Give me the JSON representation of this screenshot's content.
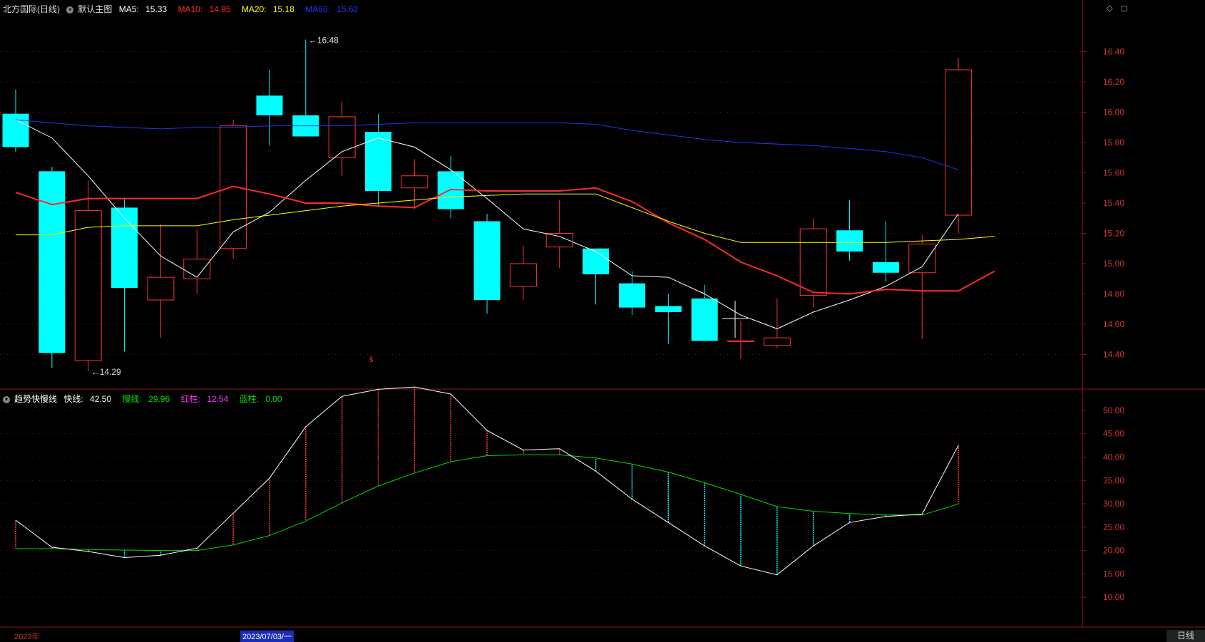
{
  "main_header": {
    "stock": "北方国际(日线)",
    "template": "默认主图",
    "ma5_label": "MA5:",
    "ma5_value": "15.33",
    "ma5_color": "#ffffff",
    "ma10_label": "MA10:",
    "ma10_value": "14.95",
    "ma10_color": "#ff2a2a",
    "ma20_label": "MA20:",
    "ma20_value": "15.18",
    "ma20_color": "#ffff00",
    "ma60_label": "MA60:",
    "ma60_value": "15.62",
    "ma60_color": "#2233ff"
  },
  "sub_header": {
    "indicator": "趋势快慢线",
    "fast_label": "快线:",
    "fast_value": "42.50",
    "slow_label": "慢线:",
    "slow_value": "29.96",
    "red_label": "红柱:",
    "red_value": "12.54",
    "blue_label": "蓝柱:",
    "blue_value": "0.00"
  },
  "x_labels": {
    "start": "2023年",
    "cursor": "2023/07/03/一"
  },
  "period_tab": "日线",
  "window_icons": "◇ ◻",
  "colors": {
    "up": "#ff3333",
    "down": "#00ffff",
    "fast": "#ffffff",
    "slow": "#00dd00"
  },
  "chart_data": [
    {
      "type": "candlestick",
      "ylim": [
        14.2,
        16.6
      ],
      "yticks": [
        "14.40",
        "14.60",
        "14.80",
        "15.00",
        "15.20",
        "15.40",
        "15.60",
        "15.80",
        "16.00",
        "16.20",
        "16.40"
      ],
      "annotations": [
        {
          "text": "16.48",
          "value": 16.48,
          "index": 8
        },
        {
          "text": "14.29",
          "value": 14.29,
          "index": 2
        }
      ],
      "candles": [
        {
          "o": 15.99,
          "h": 16.15,
          "l": 15.74,
          "c": 15.77
        },
        {
          "o": 15.61,
          "h": 15.64,
          "l": 14.31,
          "c": 14.41
        },
        {
          "o": 14.36,
          "h": 15.55,
          "l": 14.29,
          "c": 15.35
        },
        {
          "o": 15.37,
          "h": 15.43,
          "l": 14.42,
          "c": 14.84
        },
        {
          "o": 14.76,
          "h": 15.26,
          "l": 14.51,
          "c": 14.91
        },
        {
          "o": 14.9,
          "h": 15.23,
          "l": 14.8,
          "c": 15.03
        },
        {
          "o": 15.1,
          "h": 15.95,
          "l": 15.03,
          "c": 15.91
        },
        {
          "o": 16.11,
          "h": 16.28,
          "l": 15.78,
          "c": 15.98
        },
        {
          "o": 15.98,
          "h": 16.48,
          "l": 15.84,
          "c": 15.84
        },
        {
          "o": 15.7,
          "h": 16.07,
          "l": 15.58,
          "c": 15.97
        },
        {
          "o": 15.87,
          "h": 15.99,
          "l": 15.38,
          "c": 15.48
        },
        {
          "o": 15.5,
          "h": 15.69,
          "l": 15.36,
          "c": 15.58
        },
        {
          "o": 15.61,
          "h": 15.71,
          "l": 15.3,
          "c": 15.36
        },
        {
          "o": 15.28,
          "h": 15.33,
          "l": 14.67,
          "c": 14.76
        },
        {
          "o": 14.85,
          "h": 15.12,
          "l": 14.76,
          "c": 15.0
        },
        {
          "o": 15.11,
          "h": 15.42,
          "l": 14.97,
          "c": 15.2
        },
        {
          "o": 15.1,
          "h": 15.1,
          "l": 14.73,
          "c": 14.93
        },
        {
          "o": 14.87,
          "h": 14.95,
          "l": 14.66,
          "c": 14.71
        },
        {
          "o": 14.72,
          "h": 14.8,
          "l": 14.47,
          "c": 14.68
        },
        {
          "o": 14.77,
          "h": 14.86,
          "l": 14.49,
          "c": 14.49
        },
        {
          "o": 14.49,
          "h": 14.62,
          "l": 14.37,
          "c": 14.49
        },
        {
          "o": 14.46,
          "h": 14.77,
          "l": 14.44,
          "c": 14.51
        },
        {
          "o": 14.79,
          "h": 15.3,
          "l": 14.71,
          "c": 15.23
        },
        {
          "o": 15.22,
          "h": 15.42,
          "l": 15.02,
          "c": 15.08
        },
        {
          "o": 15.01,
          "h": 15.28,
          "l": 14.88,
          "c": 14.94
        },
        {
          "o": 14.94,
          "h": 15.19,
          "l": 14.5,
          "c": 15.13
        },
        {
          "o": 15.32,
          "h": 16.36,
          "l": 15.2,
          "c": 16.28
        }
      ],
      "series": [
        {
          "name": "MA5",
          "values": [
            15.95,
            15.83,
            15.58,
            15.3,
            15.05,
            14.91,
            15.21,
            15.34,
            15.55,
            15.74,
            15.83,
            15.77,
            15.62,
            15.43,
            15.23,
            15.18,
            15.08,
            14.92,
            14.91,
            14.8,
            14.66,
            14.57,
            14.68,
            14.76,
            14.85,
            14.98,
            15.33
          ]
        },
        {
          "name": "MA10",
          "values": [
            15.47,
            15.39,
            15.43,
            15.43,
            15.43,
            15.43,
            15.51,
            15.46,
            15.4,
            15.4,
            15.38,
            15.37,
            15.49,
            15.48,
            15.48,
            15.48,
            15.5,
            15.41,
            15.27,
            15.16,
            15.01,
            14.92,
            14.81,
            14.8,
            14.83,
            14.82,
            14.82,
            14.95
          ]
        },
        {
          "name": "MA20",
          "values": [
            15.19,
            15.19,
            15.24,
            15.25,
            15.25,
            15.25,
            15.29,
            15.32,
            15.35,
            15.38,
            15.4,
            15.42,
            15.44,
            15.45,
            15.46,
            15.46,
            15.46,
            15.37,
            15.28,
            15.2,
            15.14,
            15.14,
            15.14,
            15.14,
            15.14,
            15.15,
            15.16,
            15.18
          ]
        },
        {
          "name": "MA60",
          "values": [
            15.95,
            15.93,
            15.91,
            15.9,
            15.89,
            15.9,
            15.9,
            15.91,
            15.91,
            15.91,
            15.92,
            15.93,
            15.93,
            15.93,
            15.93,
            15.93,
            15.92,
            15.88,
            15.85,
            15.82,
            15.8,
            15.79,
            15.78,
            15.76,
            15.74,
            15.7,
            15.62
          ]
        }
      ]
    },
    {
      "type": "line",
      "title": "趋势快慢线",
      "ylim": [
        5,
        57
      ],
      "yticks": [
        "10.00",
        "15.00",
        "20.00",
        "25.00",
        "30.00",
        "35.00",
        "40.00",
        "45.00",
        "50.00"
      ],
      "series": [
        {
          "name": "快线",
          "values": [
            26.5,
            20.7,
            19.8,
            18.5,
            19.0,
            20.5,
            28.0,
            35.5,
            46.5,
            53.0,
            54.5,
            55.0,
            53.5,
            45.7,
            41.5,
            41.8,
            37.0,
            31.0,
            26.0,
            21.0,
            16.7,
            14.8,
            21.0,
            26.0,
            27.3,
            27.8,
            42.5
          ]
        },
        {
          "name": "慢线",
          "values": [
            20.4,
            20.4,
            20.2,
            20.1,
            20.0,
            20.0,
            21.2,
            23.2,
            26.3,
            30.2,
            33.8,
            36.6,
            39.0,
            40.3,
            40.5,
            40.5,
            39.8,
            38.5,
            36.8,
            34.5,
            32.0,
            29.4,
            28.4,
            27.9,
            27.6,
            27.6,
            29.96
          ]
        }
      ]
    }
  ]
}
